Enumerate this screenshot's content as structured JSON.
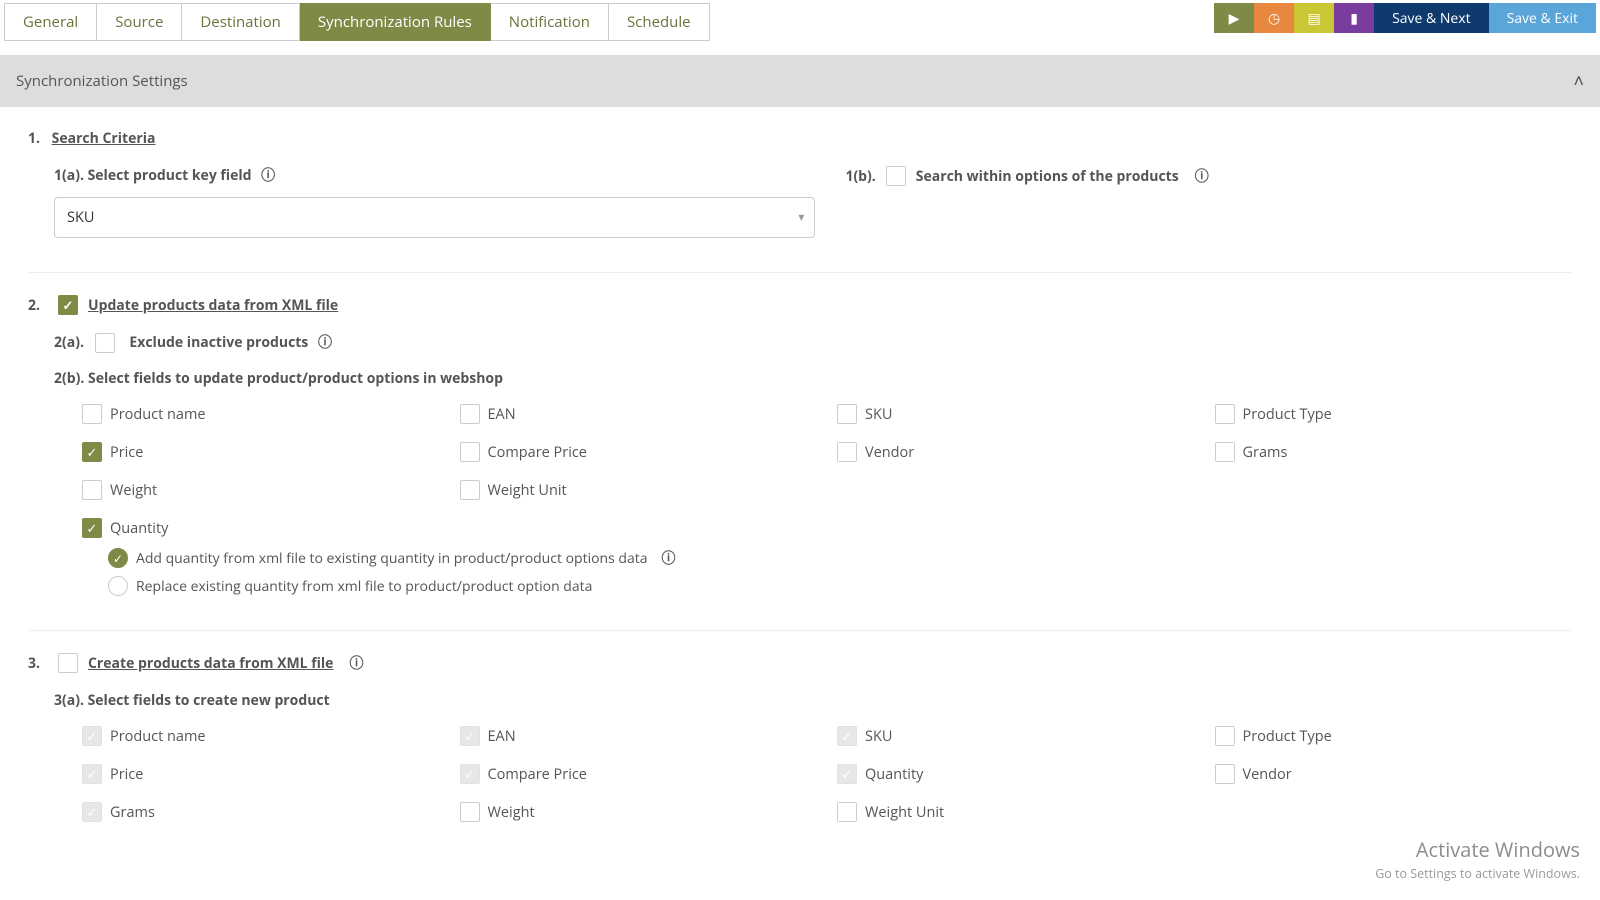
{
  "tabs": [
    {
      "label": "General"
    },
    {
      "label": "Source"
    },
    {
      "label": "Destination"
    },
    {
      "label": "Synchronization Rules"
    },
    {
      "label": "Notification"
    },
    {
      "label": "Schedule"
    }
  ],
  "actions": {
    "icons": [
      "play-icon",
      "gauge-icon",
      "note-icon",
      "book-icon"
    ],
    "save_next": "Save & Next",
    "save_exit": "Save & Exit"
  },
  "panel": {
    "title": "Synchronization Settings"
  },
  "sec1": {
    "num": "1.",
    "title": "Search Criteria",
    "a_label": "1(a). Select product key field",
    "a_value": "SKU",
    "b_prefix": "1(b).",
    "b_label": "Search within options of the products"
  },
  "sec2": {
    "num": "2.",
    "title": "Update products data from XML file",
    "checked": true,
    "a_prefix": "2(a).",
    "a_label": "Exclude inactive products",
    "b_prefix": "2(b). Select fields to update product/product options in webshop",
    "fields": [
      {
        "label": "Product name",
        "on": false
      },
      {
        "label": "EAN",
        "on": false
      },
      {
        "label": "SKU",
        "on": false
      },
      {
        "label": "Product Type",
        "on": false
      },
      {
        "label": "Price",
        "on": true
      },
      {
        "label": "Compare Price",
        "on": false
      },
      {
        "label": "Vendor",
        "on": false
      },
      {
        "label": "Grams",
        "on": false
      },
      {
        "label": "Weight",
        "on": false
      },
      {
        "label": "Weight Unit",
        "on": false
      }
    ],
    "quantity": {
      "label": "Quantity",
      "on": true
    },
    "radios": {
      "add": "Add quantity from xml file to existing quantity in product/product options data",
      "replace": "Replace existing quantity from xml file to product/product option data"
    }
  },
  "sec3": {
    "num": "3.",
    "title": "Create products data from XML file",
    "checked": false,
    "a_prefix": "3(a). Select fields to create new product",
    "fields": [
      {
        "label": "Product name",
        "disabled": true
      },
      {
        "label": "EAN",
        "disabled": true
      },
      {
        "label": "SKU",
        "disabled": true
      },
      {
        "label": "Product Type",
        "disabled": false
      },
      {
        "label": "Price",
        "disabled": true
      },
      {
        "label": "Compare Price",
        "disabled": true
      },
      {
        "label": "Quantity",
        "disabled": true
      },
      {
        "label": "Vendor",
        "disabled": false
      },
      {
        "label": "Grams",
        "disabled": true
      },
      {
        "label": "Weight",
        "disabled": false
      },
      {
        "label": "Weight Unit",
        "disabled": false
      }
    ]
  },
  "watermark": {
    "line1": "Activate Windows",
    "line2": "Go to Settings to activate Windows."
  }
}
